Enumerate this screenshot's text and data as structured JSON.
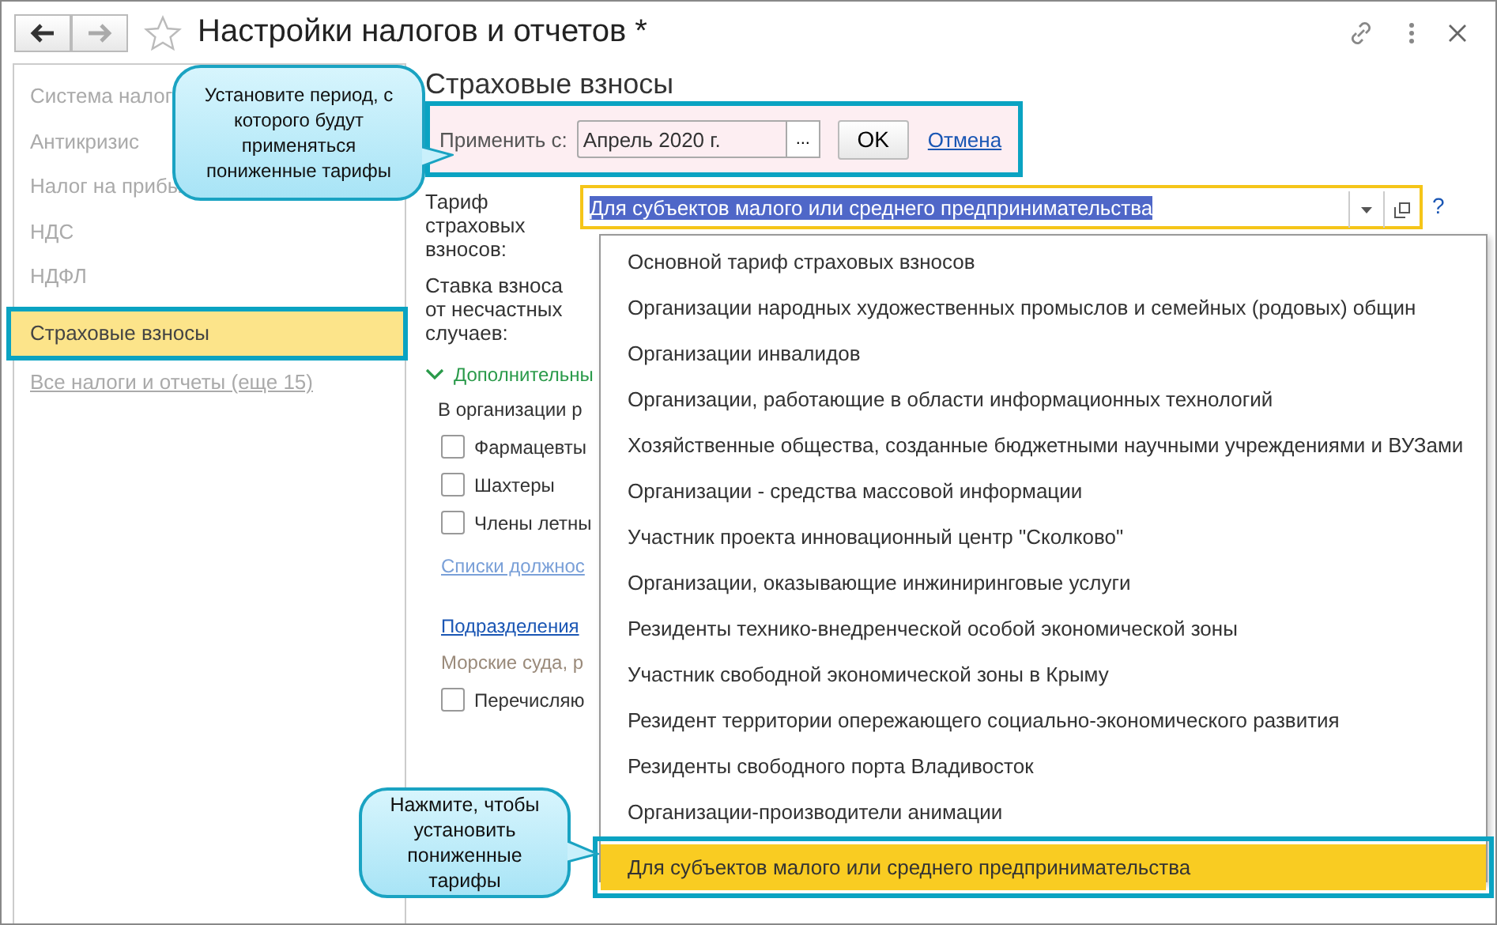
{
  "window": {
    "title": "Настройки налогов и отчетов *"
  },
  "sidebar": {
    "items": [
      {
        "label": "Система налог",
        "kind": "item",
        "selected": false
      },
      {
        "label": "Антикризис",
        "kind": "item",
        "selected": false
      },
      {
        "label": "Налог на прибы",
        "kind": "item",
        "selected": false
      },
      {
        "label": "НДС",
        "kind": "item",
        "selected": false
      },
      {
        "label": "НДФЛ",
        "kind": "item",
        "selected": false
      },
      {
        "label": "Страховые взносы",
        "kind": "item",
        "selected": true
      },
      {
        "label": "Все налоги и отчеты (еще 15)",
        "kind": "link",
        "selected": false
      }
    ]
  },
  "form": {
    "heading": "Страховые взносы",
    "apply": {
      "label": "Применить с:",
      "value": "Апрель 2020 г.",
      "choose": "...",
      "ok": "OK",
      "cancel": "Отмена"
    },
    "tariff": {
      "label": "Тариф страховых взносов:",
      "value": "Для субъектов малого или среднего предпринимательства",
      "help": "?"
    },
    "accident": {
      "label": "Ставка взноса от несчастных случаев:"
    },
    "section": {
      "label": "Дополнительны",
      "expanded": true
    },
    "rows": [
      {
        "kind": "text",
        "label": "В организации р"
      },
      {
        "kind": "checkbox",
        "label": "Фармацевты",
        "checked": false
      },
      {
        "kind": "checkbox",
        "label": "Шахтеры",
        "checked": false
      },
      {
        "kind": "checkbox",
        "label": "Члены летны",
        "checked": false
      },
      {
        "kind": "faint-link",
        "label": "Списки должнос"
      },
      {
        "kind": "link",
        "label": "Подразделения"
      },
      {
        "kind": "note",
        "label": "Морские суда, р"
      },
      {
        "kind": "checkbox",
        "label": "Перечисляю",
        "checked": false
      }
    ]
  },
  "dropdown": {
    "items": [
      {
        "label": "Основной тариф страховых взносов",
        "selected": false
      },
      {
        "label": "Организации народных художественных промыслов и семейных (родовых) общин",
        "selected": false
      },
      {
        "label": "Организации инвалидов",
        "selected": false
      },
      {
        "label": "Организации, работающие в области информационных технологий",
        "selected": false
      },
      {
        "label": "Хозяйственные общества, созданные бюджетными научными учреждениями и ВУЗами",
        "selected": false
      },
      {
        "label": "Организации - средства массовой информации",
        "selected": false
      },
      {
        "label": "Участник проекта инновационный центр \"Сколково\"",
        "selected": false
      },
      {
        "label": "Организации, оказывающие инжиниринговые услуги",
        "selected": false
      },
      {
        "label": "Резиденты технико-внедренческой особой экономической зоны",
        "selected": false
      },
      {
        "label": "Участник свободной экономической зоны в Крыму",
        "selected": false
      },
      {
        "label": "Резидент территории опережающего социально-экономического развития",
        "selected": false
      },
      {
        "label": "Резиденты свободного порта Владивосток",
        "selected": false
      },
      {
        "label": "Организации-производители анимации",
        "selected": false
      },
      {
        "label": "Для субъектов малого или среднего предпринимательства",
        "selected": true
      }
    ]
  },
  "callouts": [
    {
      "text": "Установите период, с которого будут применяться пониженные тарифы"
    },
    {
      "text": "Нажмите, чтобы установить пониженные тарифы"
    }
  ]
}
